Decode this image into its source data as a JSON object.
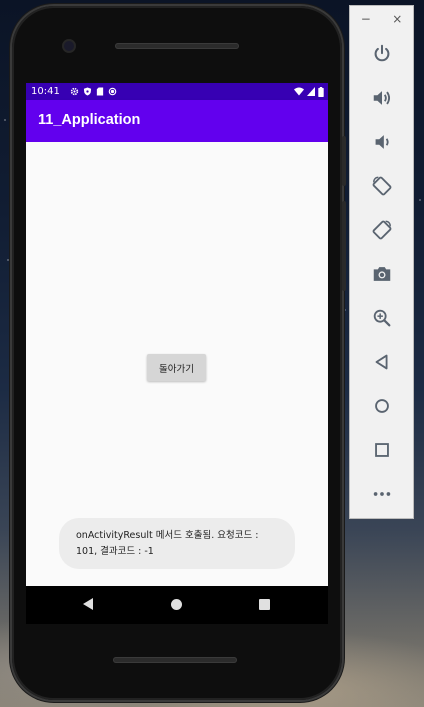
{
  "status_bar": {
    "time": "10:41",
    "left_icons": [
      "gear-icon",
      "shield-icon",
      "sd-card-icon",
      "sync-icon"
    ],
    "right_icons": [
      "wifi-icon",
      "signal-icon",
      "battery-icon"
    ]
  },
  "app_bar": {
    "title": "11_Application"
  },
  "content": {
    "back_button_label": "돌아가기"
  },
  "toast": {
    "message_line1": "onActivityResult 메서드 호출됨. 요청코드 :",
    "message_line2": "101, 결과코드 : -1"
  },
  "emulator_toolbar": {
    "minimize_label": "−",
    "close_label": "×",
    "buttons": [
      "power-icon",
      "volume-up-icon",
      "volume-down-icon",
      "rotate-left-icon",
      "rotate-right-icon",
      "camera-icon",
      "zoom-icon",
      "back-icon",
      "home-icon",
      "overview-icon",
      "more-icon"
    ]
  },
  "colors": {
    "status_bar": "#3700b3",
    "app_bar": "#6200ee",
    "content_bg": "#fafafa"
  }
}
